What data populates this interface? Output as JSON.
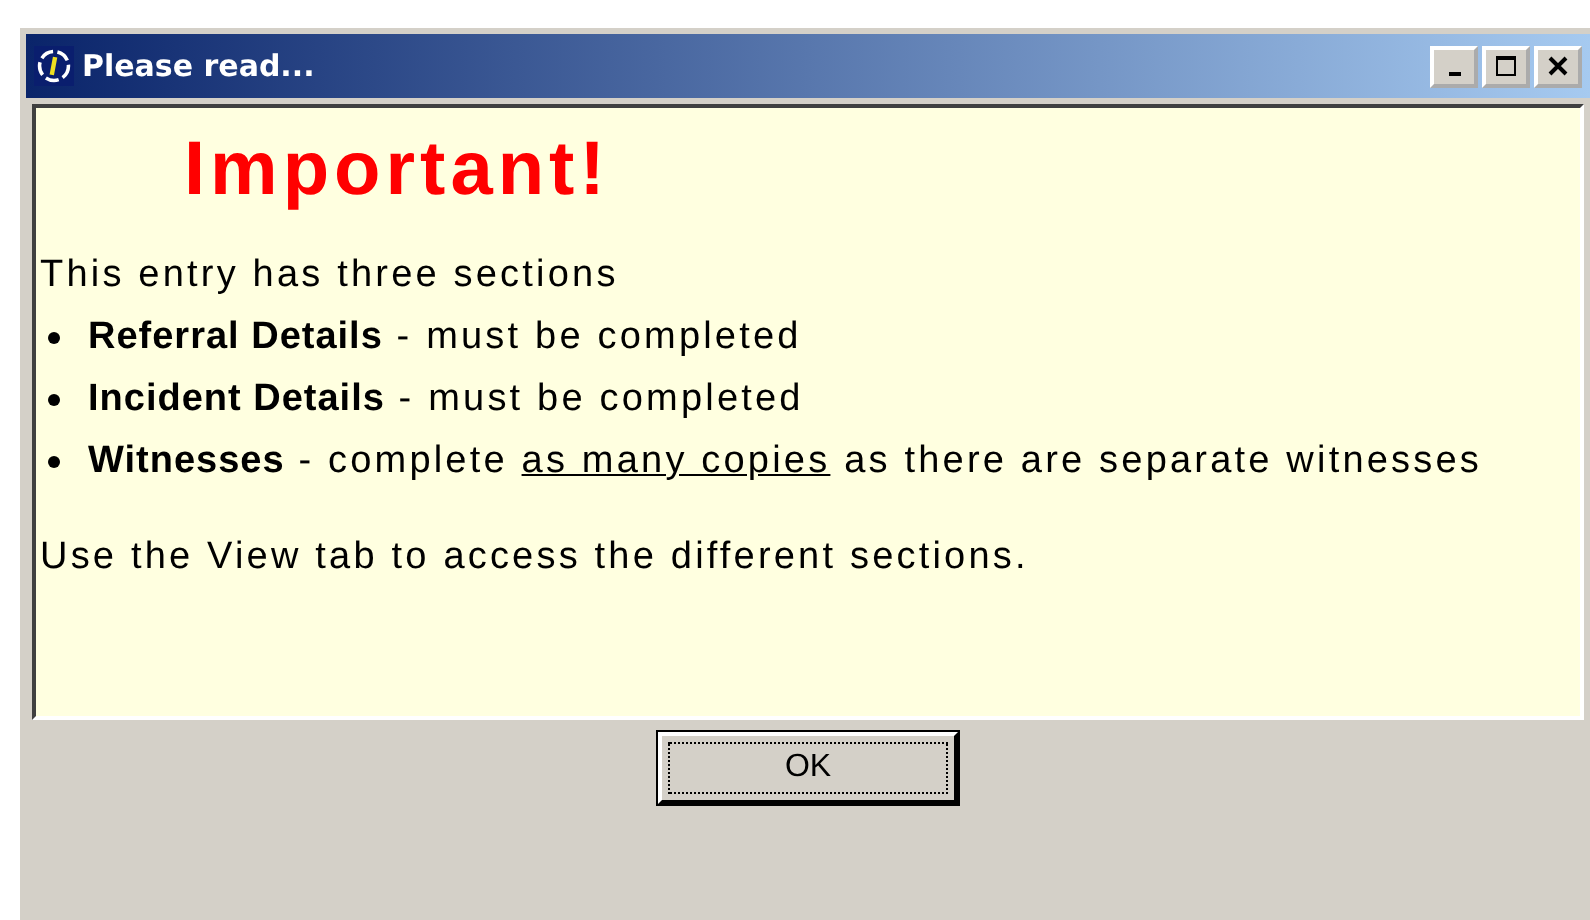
{
  "window": {
    "title": "Please read..."
  },
  "heading": "Important!",
  "intro": "This entry has three sections",
  "bullets": [
    {
      "parts": [
        {
          "kind": "term",
          "text": "Referral Details"
        },
        {
          "kind": "plain",
          "text": " - must be completed"
        }
      ]
    },
    {
      "parts": [
        {
          "kind": "term",
          "text": "Incident Details"
        },
        {
          "kind": "plain",
          "text": " - must be completed"
        }
      ]
    },
    {
      "parts": [
        {
          "kind": "term",
          "text": "Witnesses"
        },
        {
          "kind": "plain",
          "text": " - complete "
        },
        {
          "kind": "emphasis",
          "text": "as many copies"
        },
        {
          "kind": "plain",
          "text": " as there are separate witnesses"
        }
      ]
    }
  ],
  "footer": "Use the View tab to access the different sections.",
  "buttons": [
    {
      "label": "OK",
      "focused": true
    }
  ]
}
